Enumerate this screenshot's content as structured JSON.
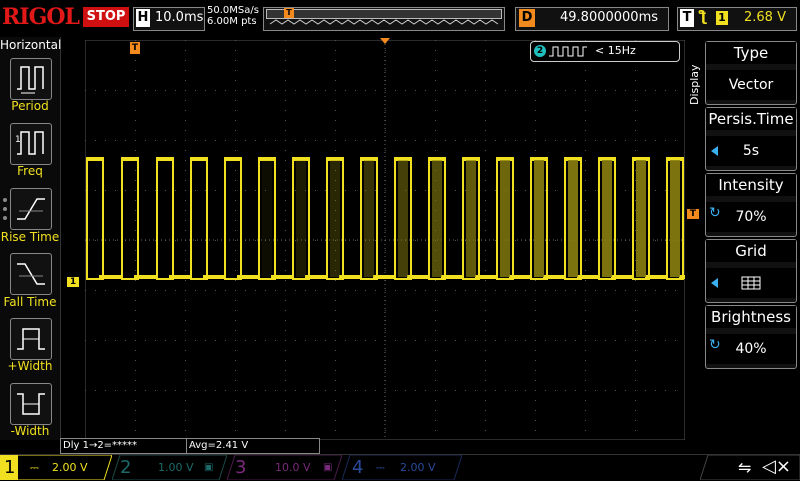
{
  "header": {
    "logo": "RIGOL",
    "run_state": "STOP",
    "timebase_label": "H",
    "timebase_value": "10.0ms",
    "sample_rate": "50.0MSa/s",
    "sample_depth": "6.00M pts",
    "trigger_delay_label": "D",
    "trigger_delay_value": "49.8000000ms",
    "trigger_label": "T",
    "trigger_source": "1",
    "trigger_level": "2.68 V"
  },
  "left_menu": {
    "title": "Horizontal",
    "items": [
      {
        "label": "Period",
        "icon": "period-icon"
      },
      {
        "label": "Freq",
        "icon": "freq-icon"
      },
      {
        "label": "Rise Time",
        "icon": "rise-time-icon"
      },
      {
        "label": "Fall Time",
        "icon": "fall-time-icon"
      },
      {
        "label": "+Width",
        "icon": "positive-width-icon"
      },
      {
        "label": "-Width",
        "icon": "negative-width-icon"
      }
    ]
  },
  "screen": {
    "ch2_freq_badge": "2",
    "ch2_freq_text": "< 15Hz",
    "ch1_marker": "1",
    "trigger_marker": "T"
  },
  "right_menu": {
    "side_label": "Display",
    "items": [
      {
        "title": "Type",
        "value": "Vector"
      },
      {
        "title": "Persis.Time",
        "value": "5s"
      },
      {
        "title": "Intensity",
        "value": "70%"
      },
      {
        "title": "Grid",
        "value": ""
      },
      {
        "title": "Brightness",
        "value": "40%"
      }
    ]
  },
  "measurements": {
    "delay": "Dly 1→2=*****",
    "average": "Avg=2.41 V"
  },
  "channels": [
    {
      "num": "1",
      "value": "2.00 V",
      "color": "#f0e020"
    },
    {
      "num": "2",
      "value": "1.00 V",
      "color": "#20c0c0"
    },
    {
      "num": "3",
      "value": "10.0 V",
      "color": "#d040d0"
    },
    {
      "num": "4",
      "value": "2.00 V",
      "color": "#3a80f0"
    }
  ],
  "colors": {
    "ch1": "#f0e020",
    "trigger": "#f28a1e",
    "accent": "#3ab0f0",
    "stop": "#d01010"
  },
  "icons": {
    "usb": "usb-icon",
    "speaker": "speaker-muted-icon"
  }
}
